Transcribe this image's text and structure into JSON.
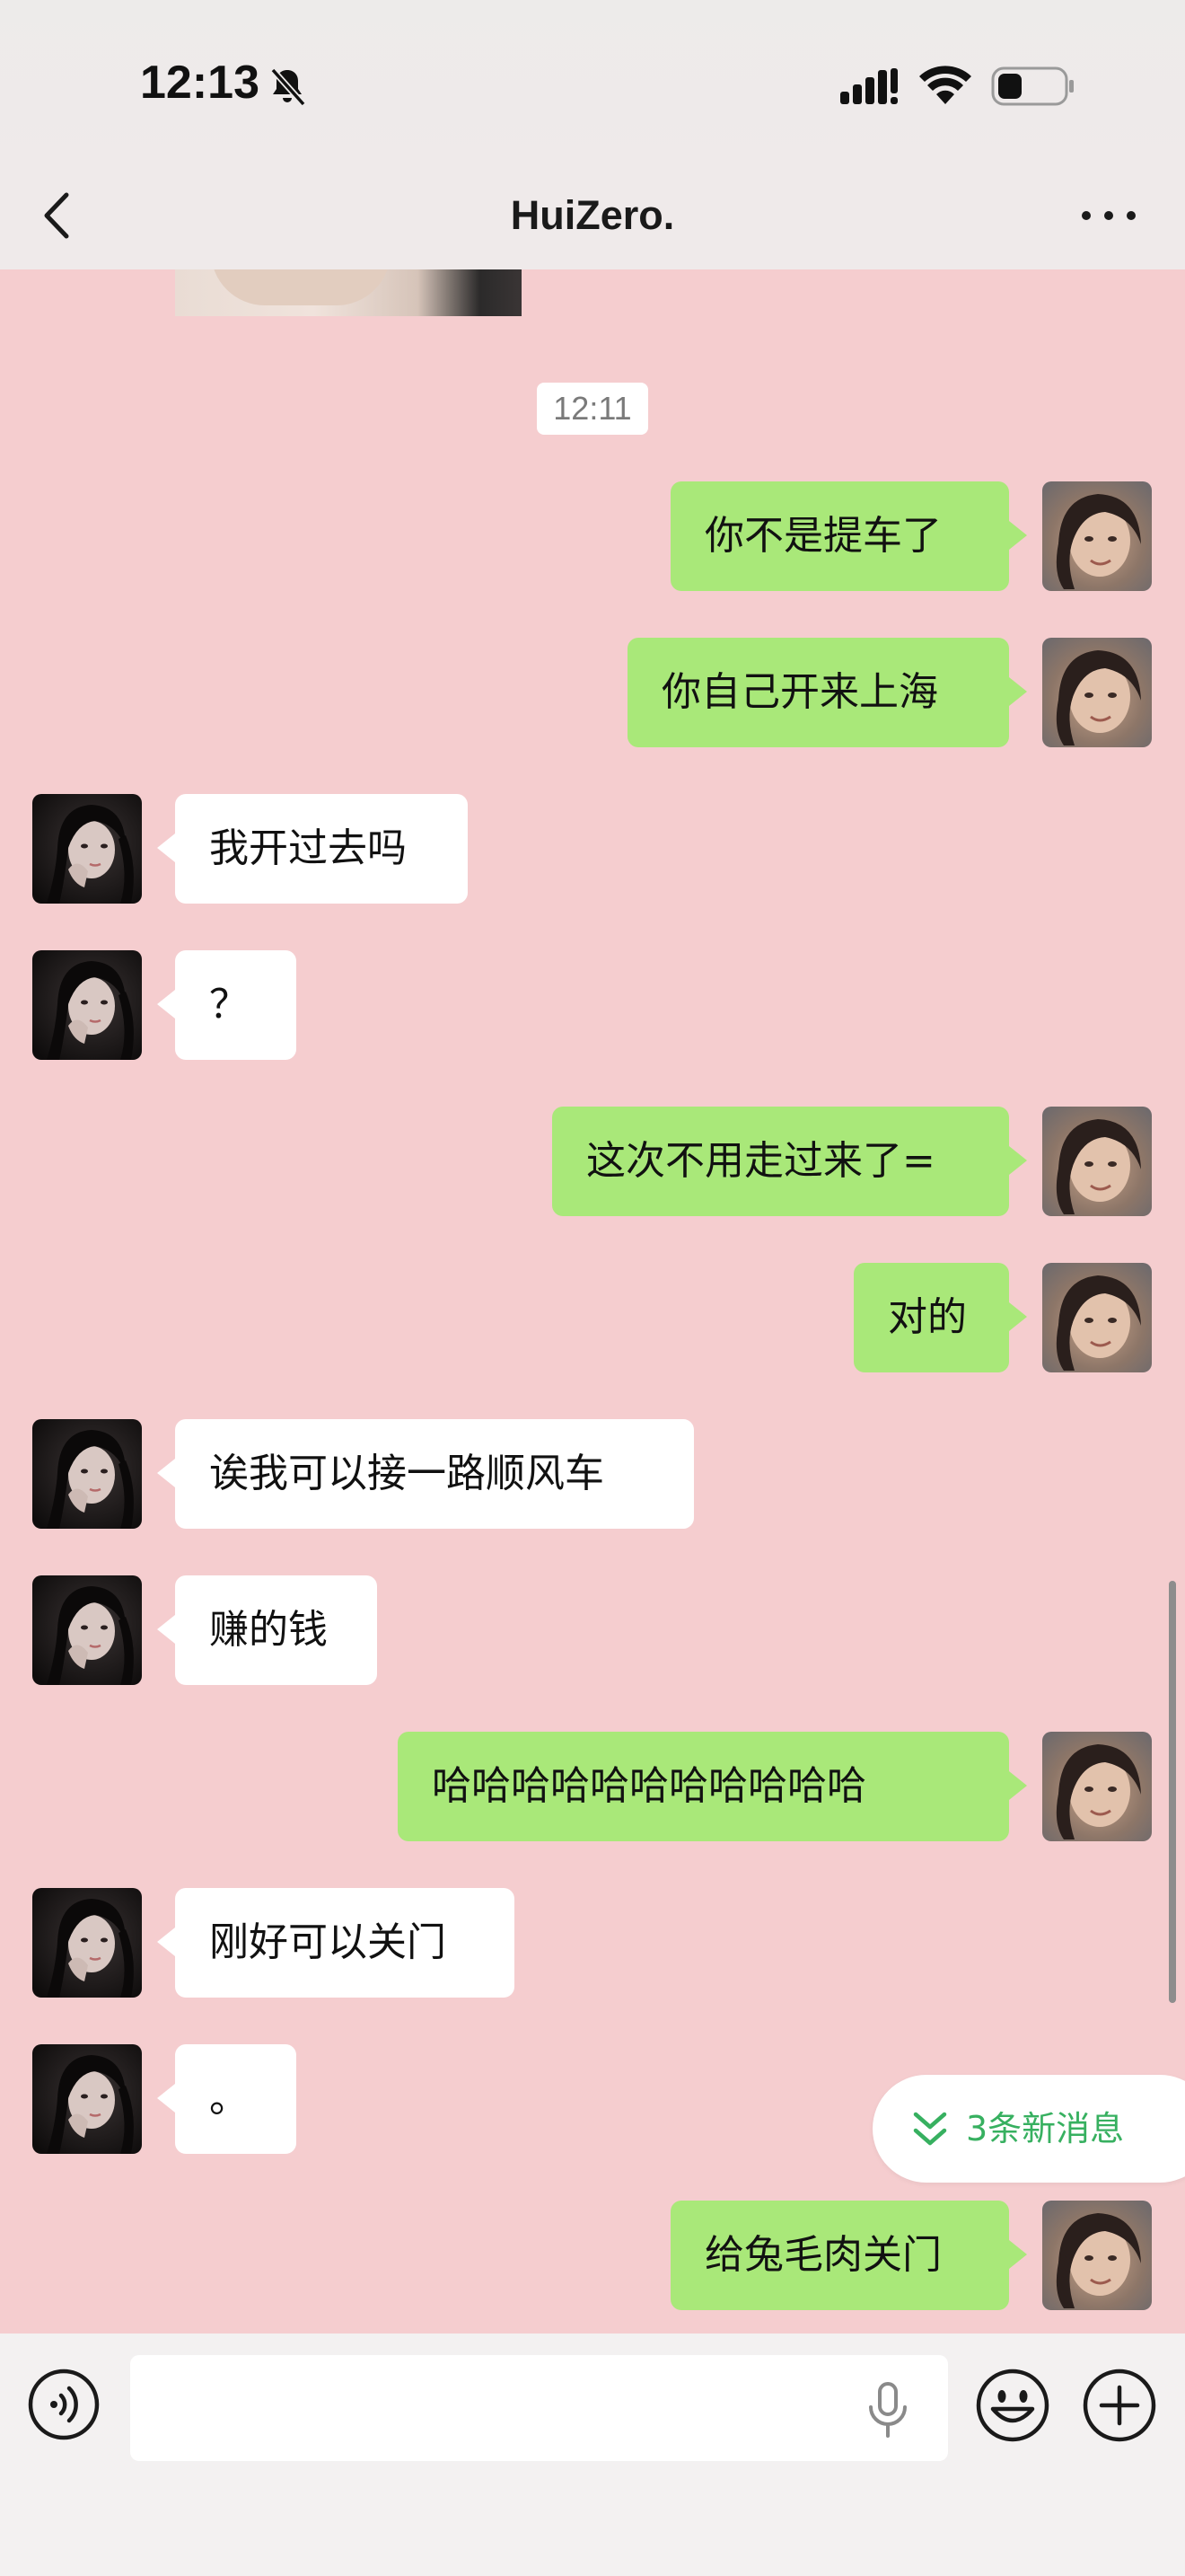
{
  "status_bar": {
    "time": "12:13",
    "icons": [
      "bell-off-icon",
      "cellular-signal-icon",
      "wifi-icon",
      "battery-icon"
    ]
  },
  "nav": {
    "title": "HuiZero.",
    "back_icon": "chevron-left-icon",
    "more_icon": "more-dots-icon"
  },
  "chat": {
    "timestamp": "12:11",
    "messages": [
      {
        "from": "me",
        "text": "你不是提车了"
      },
      {
        "from": "me",
        "text": "你自己开来上海"
      },
      {
        "from": "them",
        "text": "我开过去吗"
      },
      {
        "from": "them",
        "text": "？"
      },
      {
        "from": "me",
        "text": "这次不用走过来了="
      },
      {
        "from": "me",
        "text": "对的"
      },
      {
        "from": "them",
        "text": "诶我可以接一路顺风车"
      },
      {
        "from": "them",
        "text": "赚的钱"
      },
      {
        "from": "me",
        "text": "哈哈哈哈哈哈哈哈哈哈哈"
      },
      {
        "from": "them",
        "text": "刚好可以关门"
      },
      {
        "from": "them",
        "text": "。"
      },
      {
        "from": "me",
        "text": "给兔毛肉关门"
      }
    ],
    "new_messages_label": "3条新消息"
  },
  "input_bar": {
    "value": "",
    "placeholder": "",
    "icons": [
      "voice-icon",
      "microphone-icon",
      "emoji-icon",
      "plus-icon"
    ]
  },
  "colors": {
    "chat_background": "#F5CDCF",
    "outgoing_bubble": "#A9E879",
    "incoming_bubble": "#FFFFFF",
    "new_message_accent": "#37B060"
  }
}
